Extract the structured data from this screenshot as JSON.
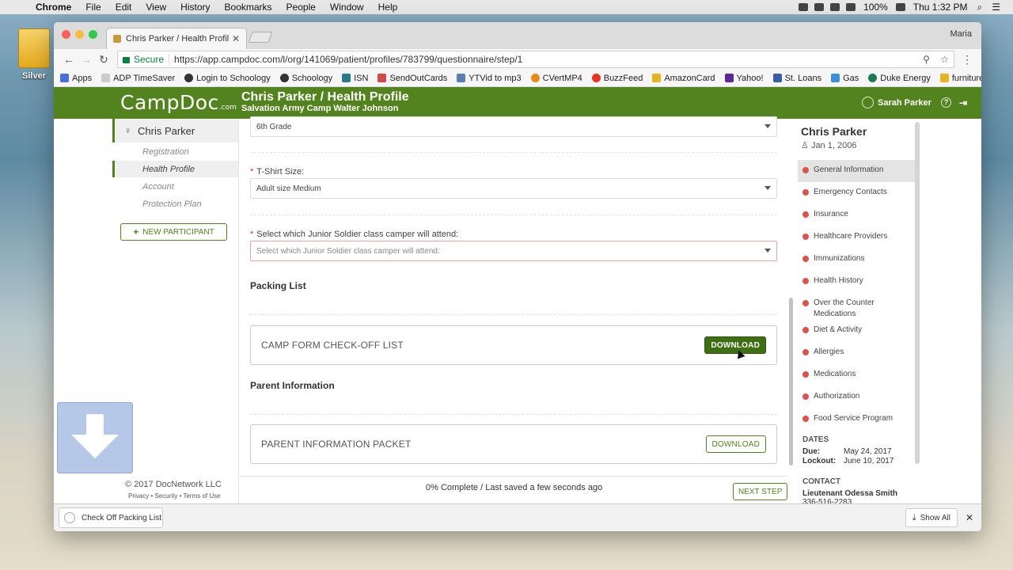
{
  "menubar": {
    "app_name": "Chrome",
    "items": [
      "File",
      "Edit",
      "View",
      "History",
      "Bookmarks",
      "People",
      "Window",
      "Help"
    ],
    "battery": "100%",
    "clock": "Thu 1:32 PM"
  },
  "desktop": {
    "drive_label": "Silver"
  },
  "browser": {
    "tab_title": "Chris Parker / Health Profile ::",
    "profile_name": "Maria",
    "secure_label": "Secure",
    "url": "https://app.campdoc.com/l/org/141069/patient/profiles/783799/questionnaire/step/1",
    "bookmarks": [
      "Apps",
      "ADP TimeSaver",
      "Login to Schoology",
      "Schoology",
      "ISN",
      "SendOutCards",
      "YTVid to mp3",
      "CVertMP4",
      "BuzzFeed",
      "AmazonCard",
      "Yahoo!",
      "St. Loans",
      "Gas",
      "Duke Energy",
      "furnitureCC"
    ],
    "bookmarks_more": "»"
  },
  "app": {
    "logo": "CampDoc",
    "logo_suffix": ".com",
    "title": "Chris Parker / Health Profile",
    "subtitle": "Salvation Army Camp Walter Johnson",
    "user_name": "Sarah Parker",
    "help_glyph": "?"
  },
  "left_nav": {
    "participant": "Chris Parker",
    "items": [
      "Registration",
      "Health Profile",
      "Account",
      "Protection Plan"
    ],
    "new_participant": "NEW PARTICIPANT",
    "copyright": "© 2017 DocNetwork LLC",
    "footer_links": "Privacy • Security • Terms of Use"
  },
  "form": {
    "grade_value": "6th Grade",
    "tshirt_label": "T-Shirt Size:",
    "tshirt_value": "Adult size Medium",
    "class_label": "Select which Junior Soldier class camper will attend:",
    "class_placeholder": "Select which Junior Soldier class camper will attend:",
    "required_mark": "*",
    "packing_title": "Packing List",
    "packing_item": "CAMP FORM CHECK-OFF LIST",
    "parent_title": "Parent Information",
    "parent_item": "PARENT INFORMATION PACKET",
    "download_label": "DOWNLOAD",
    "status": "0% Complete / Last saved a few seconds ago",
    "next_step": "NEXT STEP"
  },
  "right_panel": {
    "name": "Chris Parker",
    "dob": "Jan 1, 2006",
    "sections": [
      "General Information",
      "Emergency Contacts",
      "Insurance",
      "Healthcare Providers",
      "Immunizations",
      "Health History",
      "Over the Counter Medications",
      "Diet & Activity",
      "Allergies",
      "Medications",
      "Authorization",
      "Food Service Program"
    ],
    "dates_title": "DATES",
    "due_label": "Due:",
    "due_value": "May 24, 2017",
    "lockout_label": "Lockout:",
    "lockout_value": "June 10, 2017",
    "contact_title": "CONTACT",
    "contact_name": "Lieutenant Odessa Smith",
    "contact_phone": "336-516-2283"
  },
  "download_shelf": {
    "file_name": "Check Off Packing List.p",
    "show_all": "Show All",
    "close_glyph": "✕"
  }
}
